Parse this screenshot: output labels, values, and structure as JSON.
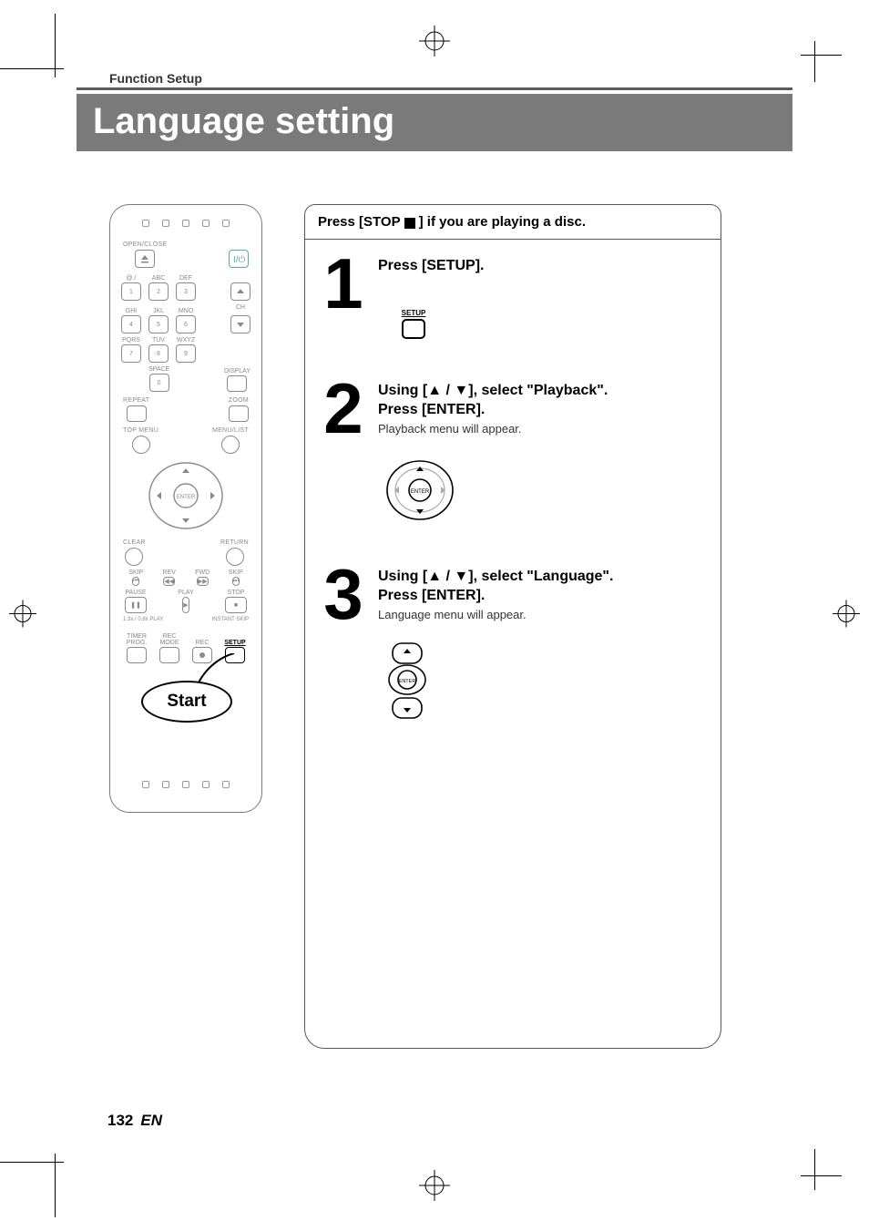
{
  "header": {
    "section_label": "Function Setup",
    "page_title": "Language setting"
  },
  "steps_header": {
    "prefix": "Press [STOP ",
    "suffix": "] if you are playing a disc."
  },
  "steps": [
    {
      "num": "1",
      "title": "Press [SETUP].",
      "sub": "",
      "icon_text": "SETUP"
    },
    {
      "num": "2",
      "title_pre": "Using [",
      "title_mid": " / ",
      "title_post": "], select \"Playback\".",
      "title_line2": "Press [ENTER].",
      "sub": "Playback menu will appear.",
      "enter_text": "ENTER"
    },
    {
      "num": "3",
      "title_pre": "Using [",
      "title_mid": " / ",
      "title_post": "], select \"Language\".",
      "title_line2": "Press [ENTER].",
      "sub": "Language menu will appear.",
      "enter_text": "ENTER"
    }
  ],
  "remote": {
    "open_close": "OPEN/CLOSE",
    "keypad": {
      "row1_labels": [
        "@./",
        "ABC",
        "DEF"
      ],
      "row1_nums": [
        "1",
        "2",
        "3"
      ],
      "row2_labels": [
        "GHI",
        "JKL",
        "MNO"
      ],
      "row2_nums": [
        "4",
        "5",
        "6"
      ],
      "row3_labels": [
        "PQRS",
        "TUV",
        "WXYZ"
      ],
      "row3_nums": [
        "7",
        "8",
        "9"
      ],
      "space_label": "SPACE",
      "zero": "0",
      "display_label": "DISPLAY",
      "ch_label": "CH"
    },
    "repeat": "REPEAT",
    "zoom": "ZOOM",
    "top_menu": "TOP MENU",
    "menu_list": "MENU/LIST",
    "clear": "CLEAR",
    "return": "RETURN",
    "enter": "ENTER",
    "transport": {
      "skip_l": "SKIP",
      "rev": "REV",
      "fwd": "FWD",
      "skip_r": "SKIP",
      "pause": "PAUSE",
      "play": "PLAY",
      "stop": "STOP",
      "slow_label": "1.3x / 0.8x PLAY",
      "instant_skip": "INSTANT SKIP"
    },
    "sub": {
      "timer": "TIMER\nPROG.",
      "recmode": "REC MODE",
      "rec": "REC",
      "setup": "SETUP"
    },
    "start_label": "Start"
  },
  "footer": {
    "page_number": "132",
    "lang": "EN"
  }
}
